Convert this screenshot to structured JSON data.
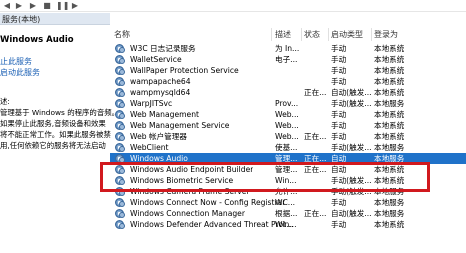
{
  "toolbar": {
    "icons": [
      "back-icon",
      "forward-icon",
      "play-icon",
      "stop-icon",
      "pause-icon",
      "restart-icon"
    ]
  },
  "left": {
    "header": "服务(本地)",
    "service_name": "Windows Audio",
    "links": [
      "止此服务",
      "启动此服务"
    ],
    "desc_title": "述:",
    "description": [
      "管理基于 Windows 的程序的音频。",
      "如果停止此服务,音频设备和效果",
      "将不能正常工作。如果此服务被禁",
      "用,任何依赖它的服务将无法启动"
    ]
  },
  "columns": [
    "名称",
    "描述",
    "状态",
    "启动类型",
    "登录为"
  ],
  "rows": [
    {
      "name": "W3C 日志记录服务",
      "desc": "为 In...",
      "status": "",
      "startup": "手动",
      "logon": "本地系统"
    },
    {
      "name": "WalletService",
      "desc": "电子...",
      "status": "",
      "startup": "手动",
      "logon": "本地系统"
    },
    {
      "name": "WallPaper Protection Service",
      "desc": "",
      "status": "",
      "startup": "手动",
      "logon": "本地系统"
    },
    {
      "name": "wampapache64",
      "desc": "",
      "status": "",
      "startup": "手动",
      "logon": "本地系统"
    },
    {
      "name": "wampmysqld64",
      "desc": "",
      "status": "正在...",
      "startup": "自动(触发...",
      "logon": "本地系统"
    },
    {
      "name": "WarpJITSvc",
      "desc": "Prov...",
      "status": "",
      "startup": "手动(触发...",
      "logon": "本地服务"
    },
    {
      "name": "Web Management",
      "desc": "Web...",
      "status": "",
      "startup": "手动",
      "logon": "本地系统"
    },
    {
      "name": "Web Management Service",
      "desc": "Web...",
      "status": "",
      "startup": "手动",
      "logon": "本地系统"
    },
    {
      "name": "Web 帐户管理器",
      "desc": "Web...",
      "status": "正在...",
      "startup": "手动",
      "logon": "本地系统"
    },
    {
      "name": "WebClient",
      "desc": "使基...",
      "status": "",
      "startup": "手动(触发...",
      "logon": "本地服务"
    },
    {
      "name": "Windows Audio",
      "desc": "管理...",
      "status": "正在...",
      "startup": "自动",
      "logon": "本地服务",
      "selected": true
    },
    {
      "name": "Windows Audio Endpoint Builder",
      "desc": "管理...",
      "status": "正在...",
      "startup": "自动",
      "logon": "本地系统"
    },
    {
      "name": "Windows Biometric Service",
      "desc": "Win...",
      "status": "",
      "startup": "手动(触发...",
      "logon": "本地系统"
    },
    {
      "name": "Windows Camera Frame Server",
      "desc": "允许...",
      "status": "",
      "startup": "手动(触发...",
      "logon": "本地服务"
    },
    {
      "name": "Windows Connect Now - Config Registrar",
      "desc": "WC...",
      "status": "",
      "startup": "手动",
      "logon": "本地服务"
    },
    {
      "name": "Windows Connection Manager",
      "desc": "根据...",
      "status": "正在...",
      "startup": "自动(触发...",
      "logon": "本地服务"
    },
    {
      "name": "Windows Defender Advanced Threat Prot...",
      "desc": "Win...",
      "status": "",
      "startup": "手动",
      "logon": "本地系统"
    }
  ]
}
